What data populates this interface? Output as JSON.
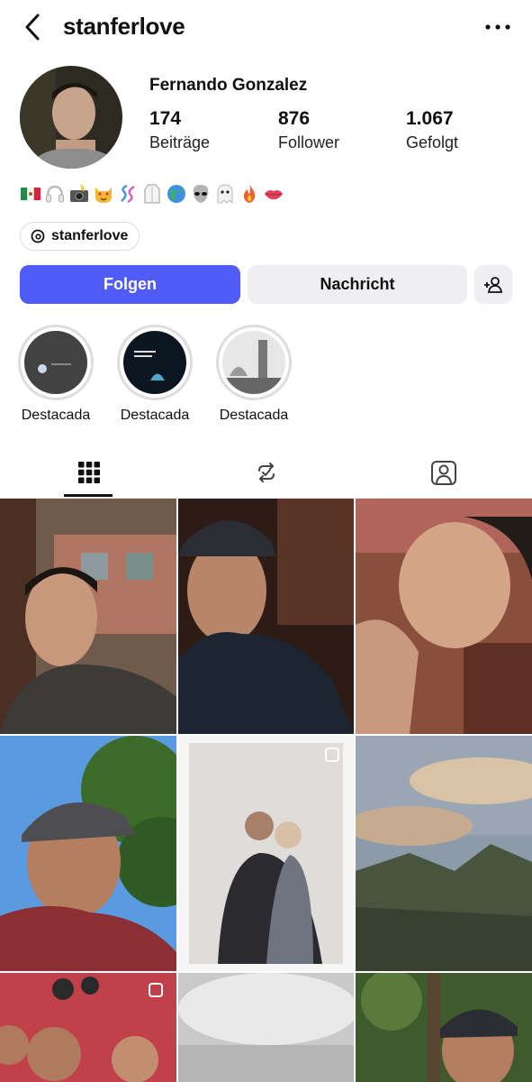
{
  "header": {
    "username": "stanferlove",
    "back_icon": "chevron-left-icon",
    "more_icon": "more-horizontal-icon"
  },
  "profile": {
    "full_name": "Fernando Gonzalez",
    "stats": [
      {
        "count": "174",
        "label": "Beiträge"
      },
      {
        "count": "876",
        "label": "Follower"
      },
      {
        "count": "1.067",
        "label": "Gefolgt"
      }
    ],
    "bio_emojis": [
      "🇲🇽",
      "🎧",
      "📸",
      "😻",
      "🧬",
      "🥼",
      "🌎",
      "👽",
      "👻",
      "🔥",
      "👄"
    ],
    "threads_handle": "stanferlove"
  },
  "actions": {
    "follow_label": "Folgen",
    "message_label": "Nachricht",
    "add_user_icon": "add-person-icon"
  },
  "highlights": [
    {
      "label": "Destacada"
    },
    {
      "label": "Destacada"
    },
    {
      "label": "Destacada"
    }
  ],
  "tabs": [
    {
      "icon": "grid-icon",
      "active": true
    },
    {
      "icon": "reels-repost-icon",
      "active": false
    },
    {
      "icon": "tagged-person-icon",
      "active": false
    }
  ],
  "colors": {
    "follow_button": "#4f5cf5",
    "secondary_button": "#efeff2"
  }
}
